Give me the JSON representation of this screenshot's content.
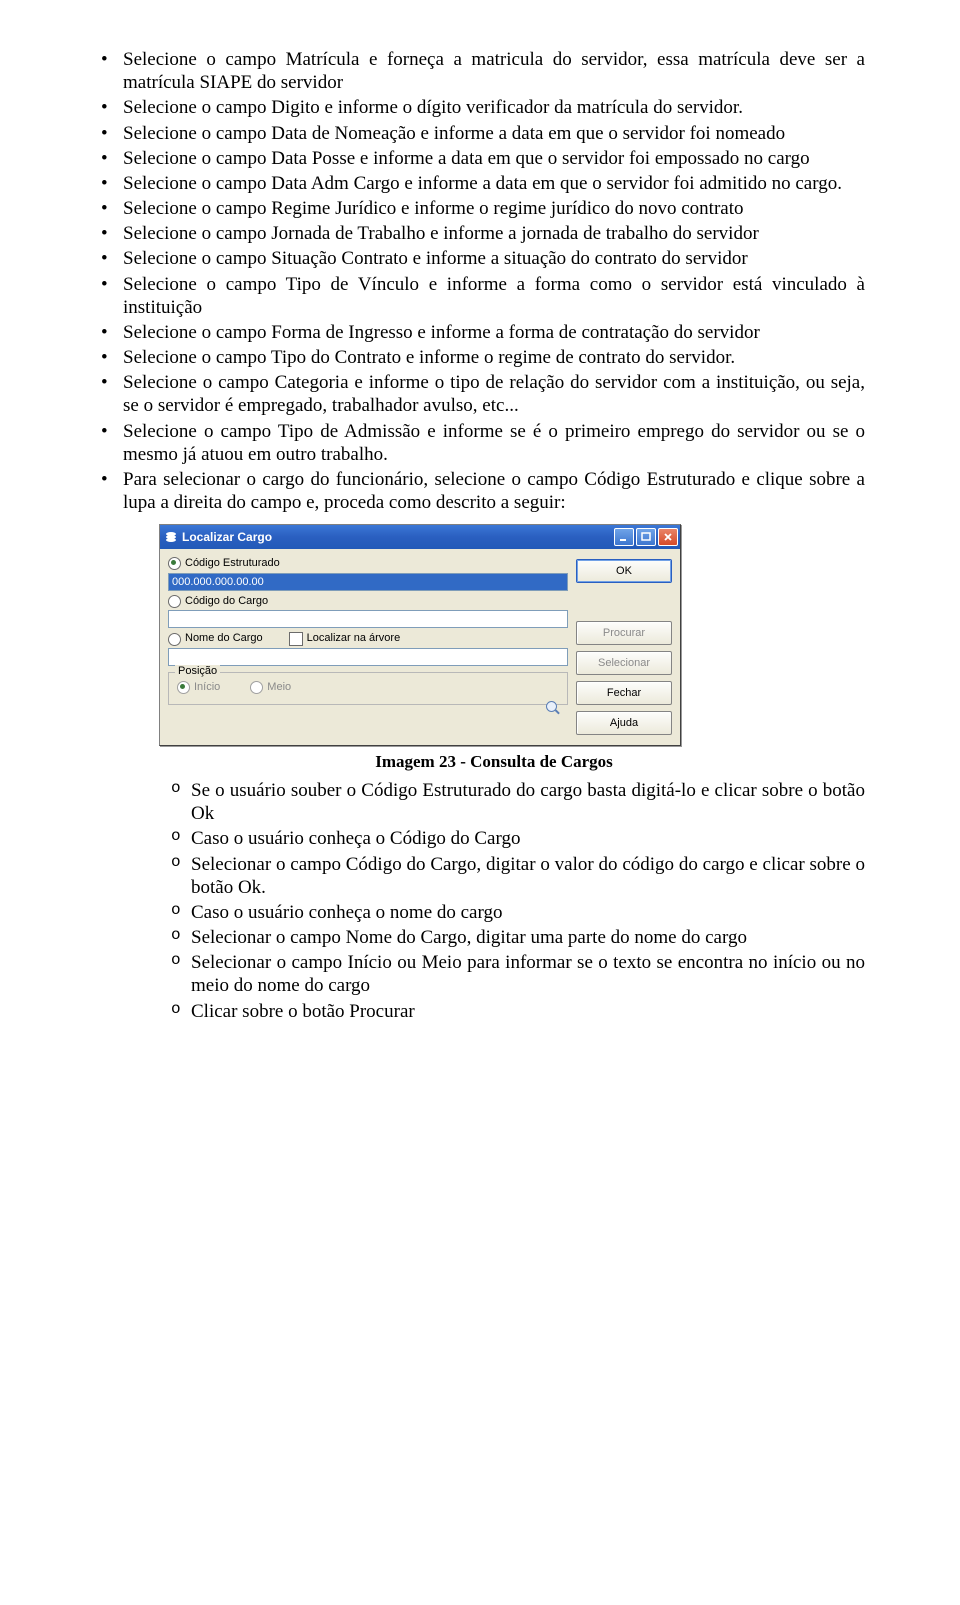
{
  "bullets": {
    "b1": "Selecione o campo Matrícula e forneça a matricula do servidor, essa matrícula deve ser a matrícula SIAPE do servidor",
    "b2": "Selecione o campo Digito e informe o dígito verificador da matrícula do servidor.",
    "b3": "Selecione o campo Data de Nomeação e informe a data em que o servidor foi nomeado",
    "b4": "Selecione o campo Data Posse e informe a data em que o servidor foi empossado no cargo",
    "b5": "Selecione o campo Data Adm Cargo e informe a data em que o servidor foi admitido no cargo.",
    "b6": "Selecione o campo Regime Jurídico e informe o regime jurídico do novo contrato",
    "b7": "Selecione o campo Jornada de Trabalho e informe a jornada de trabalho do servidor",
    "b8": "Selecione o campo Situação Contrato e informe a situação do contrato do servidor",
    "b9": "Selecione o campo Tipo de Vínculo e informe a forma como o servidor está vinculado à instituição",
    "b10": "Selecione o campo Forma de Ingresso e informe a forma de contratação do servidor",
    "b11": "Selecione o campo Tipo do Contrato e informe o regime de contrato do servidor.",
    "b12": "Selecione o campo Categoria e informe o tipo de relação do servidor com a instituição, ou seja, se o servidor é empregado, trabalhador avulso, etc...",
    "b13": "Selecione o campo Tipo de Admissão e informe se é o primeiro emprego do servidor ou se o mesmo já atuou em outro trabalho.",
    "b14": "Para selecionar o cargo do funcionário, selecione o campo Código Estruturado e clique sobre a lupa a direita do campo e, proceda como descrito a seguir:"
  },
  "dialog": {
    "title": "Localizar Cargo",
    "radios": {
      "codigo_estruturado": "Código Estruturado",
      "codigo_cargo": "Código do Cargo",
      "nome_cargo": "Nome do Cargo"
    },
    "inputs": {
      "codigo_estruturado_value": "000.000.000.00.00",
      "codigo_cargo_value": "",
      "nome_cargo_value": ""
    },
    "checkbox_label": "Localizar na árvore",
    "group_label": "Posição",
    "group_options": {
      "inicio": "Início",
      "meio": "Meio"
    },
    "buttons": {
      "ok": "OK",
      "procurar": "Procurar",
      "selecionar": "Selecionar",
      "fechar": "Fechar",
      "ajuda": "Ajuda"
    }
  },
  "caption": "Imagem 23 - Consulta de Cargos",
  "sub_bullets": {
    "s1": "Se o usuário souber o Código Estruturado do cargo basta digitá-lo e clicar sobre o botão Ok",
    "s2": "Caso o usuário conheça o Código do Cargo",
    "s3": "Selecionar o campo Código do Cargo, digitar o valor do código do cargo e clicar sobre o botão Ok.",
    "s4": "Caso o usuário conheça o nome do cargo",
    "s5": "Selecionar o campo Nome do Cargo, digitar uma parte do nome do cargo",
    "s6": "Selecionar o campo Início ou Meio para informar se o texto se encontra no início ou no meio do nome do cargo",
    "s7": "Clicar sobre o botão Procurar"
  }
}
